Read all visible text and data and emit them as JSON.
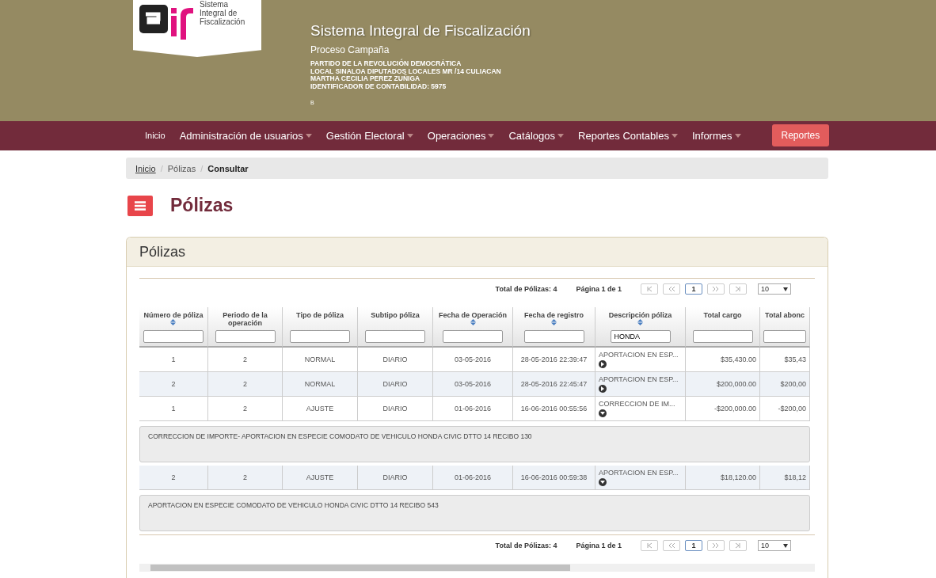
{
  "header": {
    "logo_text": [
      "Sistema",
      "Integral de",
      "Fiscalización"
    ],
    "title": "Sistema Integral de Fiscalización",
    "subtitle": "Proceso Campaña",
    "details": [
      "PARTIDO DE LA REVOLUCIÓN DEMOCRÁTICA",
      "LOCAL SINALOA DIPUTADOS LOCALES MR /14 CULIACAN",
      "MARTHA CECILIA PEREZ ZUÑIGA",
      "IDENTIFICADOR DE CONTABILIDAD: 5975"
    ],
    "note": "B"
  },
  "nav": {
    "items": [
      {
        "label": "Inicio",
        "dropdown": false
      },
      {
        "label": "Administración de usuarios",
        "dropdown": true
      },
      {
        "label": "Gestión Electoral",
        "dropdown": true
      },
      {
        "label": "Operaciones",
        "dropdown": true
      },
      {
        "label": "Catálogos",
        "dropdown": true
      },
      {
        "label": "Reportes Contables",
        "dropdown": true
      },
      {
        "label": "Informes",
        "dropdown": true
      }
    ],
    "button": "Reportes"
  },
  "breadcrumb": [
    {
      "label": "Inicio",
      "link": true
    },
    {
      "separator": "/",
      "label": "Pólizas",
      "link": false
    },
    {
      "separator": "/",
      "label": "Consultar",
      "link": false
    }
  ],
  "page_title": "Pólizas",
  "panel": {
    "title": "Pólizas",
    "pagers": [
      {
        "total": "Total de Pólizas: 4",
        "page": "Página 1 de 1",
        "current": "1",
        "page_size": "10"
      },
      {
        "total": "Total de Pólizas: 4",
        "page": "Página 1 de 1",
        "current": "1",
        "page_size": "10"
      }
    ],
    "columns": [
      {
        "label": "Número de póliza",
        "sortable": true
      },
      {
        "label": "Periodo de la operación",
        "sortable": false
      },
      {
        "label": "Tipo de póliza",
        "sortable": false
      },
      {
        "label": "Subtipo póliza",
        "sortable": false
      },
      {
        "label": "Fecha de Operación",
        "sortable": true
      },
      {
        "label": "Fecha de registro",
        "sortable": true
      },
      {
        "label": "Descripción póliza",
        "sortable": true,
        "filter": "HONDA"
      },
      {
        "label": "Total cargo",
        "sortable": false
      },
      {
        "label": "Total abonc",
        "sortable": false
      }
    ],
    "rows": [
      {
        "cells": [
          "1",
          "2",
          "NORMAL",
          "DIARIO",
          "03-05-2016",
          "28-05-2016 22:39:47",
          "APORTACION EN ESP...",
          "$35,430.00",
          "$35,43"
        ],
        "expanded": false
      },
      {
        "cells": [
          "2",
          "2",
          "NORMAL",
          "DIARIO",
          "03-05-2016",
          "28-05-2016 22:45:47",
          "APORTACION EN ESP...",
          "$200,000.00",
          "$200,00"
        ],
        "expanded": false
      },
      {
        "cells": [
          "1",
          "2",
          "AJUSTE",
          "DIARIO",
          "01-06-2016",
          "16-06-2016 00:55:56",
          "CORRECCION DE IM...",
          "-$200,000.00",
          "-$200,00"
        ],
        "expanded": true,
        "detail": "CORRECCION DE IMPORTE- APORTACION EN ESPECIE COMODATO DE VEHICULO HONDA CIVIC DTTO 14 RECIBO 130"
      },
      {
        "cells": [
          "2",
          "2",
          "AJUSTE",
          "DIARIO",
          "01-06-2016",
          "16-06-2016 00:59:38",
          "APORTACION EN ESP...",
          "$18,120.00",
          "$18,12"
        ],
        "expanded": true,
        "detail": "APORTACION EN ESPECIE COMODATO DE VEHICULO HONDA CIVIC DTTO 14 RECIBO 543"
      }
    ]
  }
}
